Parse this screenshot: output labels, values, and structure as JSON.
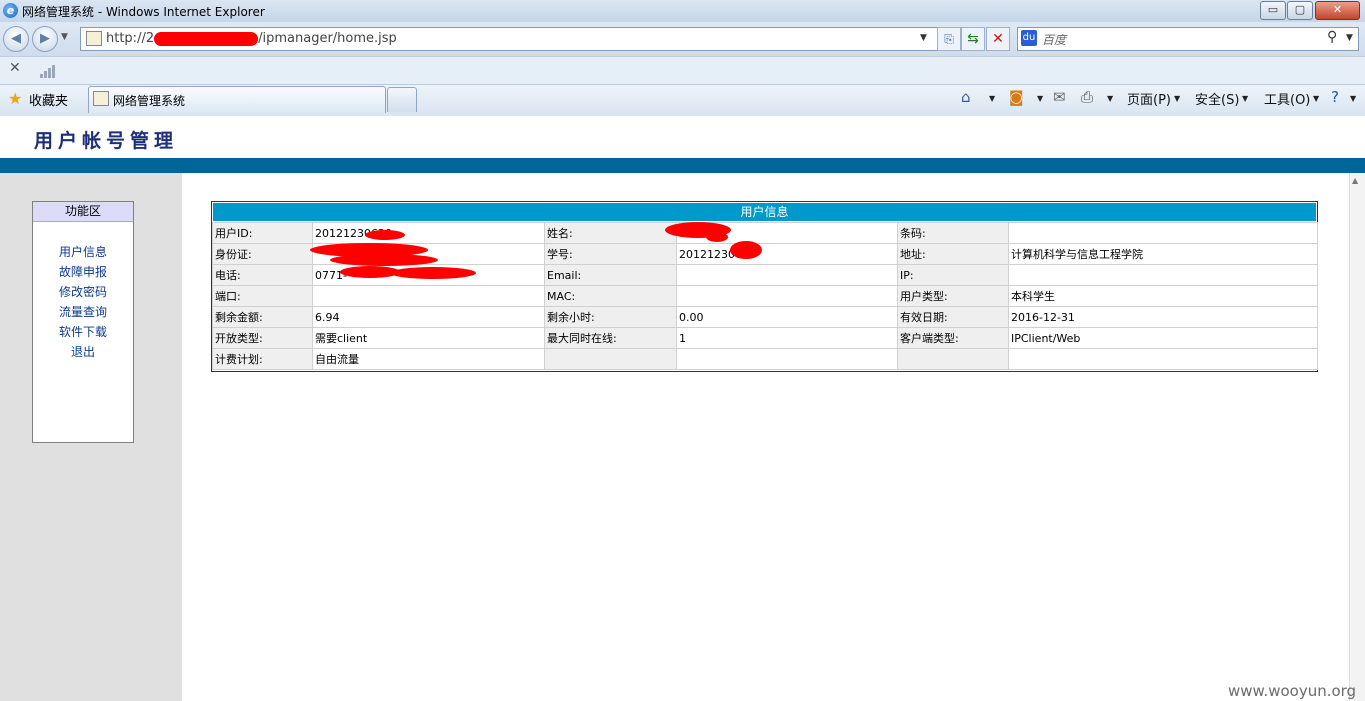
{
  "window": {
    "title": "网络管理系统 - Windows Internet Explorer",
    "min_glyph": "▭",
    "max_glyph": "▢",
    "close_glyph": "✕"
  },
  "address_bar": {
    "url_prefix": "http://2",
    "url_suffix": "/ipmanager/home.jsp"
  },
  "search": {
    "placeholder": "百度"
  },
  "favorites": {
    "label": "收藏夹"
  },
  "tab": {
    "label": "网络管理系统"
  },
  "commands": {
    "page": "页面(P)",
    "safety": "安全(S)",
    "tools": "工具(O)"
  },
  "page": {
    "heading": "用户帐号管理"
  },
  "sidebar": {
    "title": "功能区",
    "items": [
      "用户信息",
      "故障申报",
      "修改密码",
      "流量查询",
      "软件下载",
      "退出"
    ]
  },
  "user_info": {
    "title": "用户信息",
    "rows": [
      [
        {
          "l": "用户ID:",
          "v": "20121230620"
        },
        {
          "l": "姓名:",
          "v": ""
        },
        {
          "l": "条码:",
          "v": ""
        }
      ],
      [
        {
          "l": "身份证:",
          "v": ""
        },
        {
          "l": "学号:",
          "v": "20121230620"
        },
        {
          "l": "地址:",
          "v": "计算机科学与信息工程学院"
        }
      ],
      [
        {
          "l": "电话:",
          "v": "0771-"
        },
        {
          "l": "Email:",
          "v": ""
        },
        {
          "l": "IP:",
          "v": ""
        }
      ],
      [
        {
          "l": "端口:",
          "v": ""
        },
        {
          "l": "MAC:",
          "v": ""
        },
        {
          "l": "用户类型:",
          "v": "本科学生"
        }
      ],
      [
        {
          "l": "剩余金额:",
          "v": "6.94"
        },
        {
          "l": "剩余小时:",
          "v": "0.00"
        },
        {
          "l": "有效日期:",
          "v": "2016-12-31"
        }
      ],
      [
        {
          "l": "开放类型:",
          "v": "需要client"
        },
        {
          "l": "最大同时在线:",
          "v": "1"
        },
        {
          "l": "客户端类型:",
          "v": "IPClient/Web"
        }
      ],
      [
        {
          "l": "计费计划:",
          "v": "自由流量"
        },
        {
          "l": "",
          "v": ""
        },
        {
          "l": "",
          "v": ""
        }
      ]
    ]
  },
  "watermark": "www.wooyun.org",
  "colors": {
    "header_bar": "#006699",
    "table_title": "#0099cc",
    "redaction": "#ff0000"
  }
}
